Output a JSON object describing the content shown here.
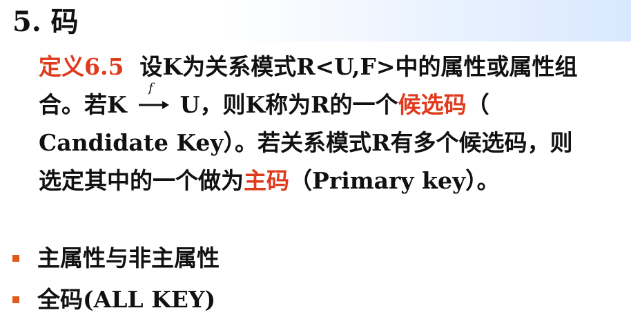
{
  "title": "5. 码",
  "definition": {
    "label": "定义6.5",
    "l1": "设K为关系模式R<U,F>中的属性或属性组",
    "l2_a": "合。若K ",
    "arrow_label": "f",
    "l2_b": "U，则K称为R的一个",
    "l2_term": "候选码",
    "l2_c": "（",
    "l3": "Candidate Key）。若关系模式R有多个候选码，则",
    "l4_a": "选定其中的一个做为",
    "l4_term": "主码",
    "l4_b": "（Primary key）。"
  },
  "bullets": [
    {
      "text": "主属性与非主属性"
    },
    {
      "text": "全码(ALL KEY)"
    }
  ],
  "colors": {
    "accent_red": "#e03a1c",
    "bullet": "#e05a1a"
  }
}
